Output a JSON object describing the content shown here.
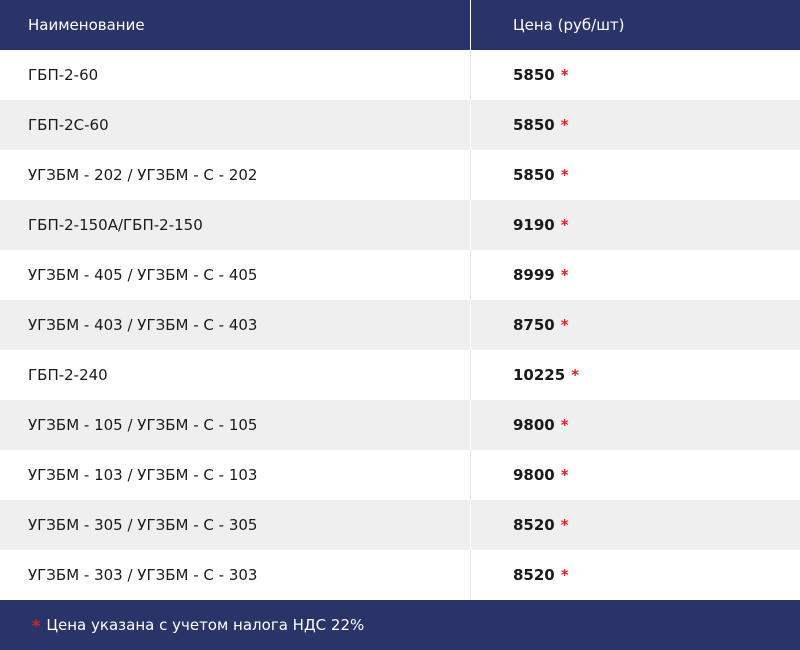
{
  "header": {
    "name_label": "Наименование",
    "price_label": "Цена (руб/шт)"
  },
  "accent_color": "#e02020",
  "header_color": "#2b3468",
  "asterisk": "*",
  "rows": [
    {
      "name": "ГБП-2-60",
      "price": "5850"
    },
    {
      "name": "ГБП-2С-60",
      "price": "5850"
    },
    {
      "name": "УГЗБМ - 202 / УГЗБМ - С - 202",
      "price": "5850"
    },
    {
      "name": "ГБП-2-150А/ГБП-2-150",
      "price": "9190"
    },
    {
      "name": "УГЗБМ - 405 / УГЗБМ - С - 405",
      "price": "8999"
    },
    {
      "name": "УГЗБМ - 403 / УГЗБМ - С - 403",
      "price": "8750"
    },
    {
      "name": "ГБП-2-240",
      "price": "10225"
    },
    {
      "name": "УГЗБМ - 105 / УГЗБМ - С - 105",
      "price": "9800"
    },
    {
      "name": "УГЗБМ - 103 / УГЗБМ - С - 103",
      "price": "9800"
    },
    {
      "name": "УГЗБМ - 305 / УГЗБМ - С - 305",
      "price": "8520"
    },
    {
      "name": "УГЗБМ - 303 / УГЗБМ - С - 303",
      "price": "8520"
    }
  ],
  "footer": {
    "note": "Цена указана с учетом налога НДС 22%"
  }
}
